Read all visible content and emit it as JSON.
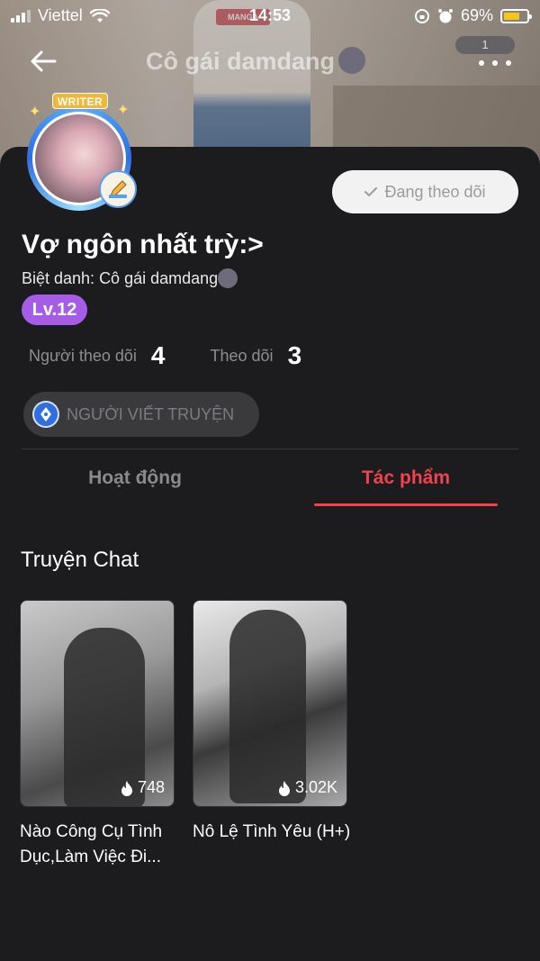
{
  "status_bar": {
    "carrier": "Viettel",
    "time": "14:53",
    "battery_percent": "69%",
    "battery_level": 0.69
  },
  "header": {
    "title": "Cô gái damdang",
    "notification_count": "1"
  },
  "profile": {
    "writer_tag": "WRITER",
    "follow_button": "Đang theo dõi",
    "name": "Vợ ngôn nhất trỳ:>",
    "nickname": "Biệt danh: Cô gái damdang",
    "level": "Lv.12",
    "followers_label": "Người theo dõi",
    "followers_count": "4",
    "following_label": "Theo dõi",
    "following_count": "3",
    "role": "NGƯỜI VIẾT TRUYỆN"
  },
  "tabs": [
    {
      "label": "Hoạt động",
      "active": false
    },
    {
      "label": "Tác phẩm",
      "active": true
    }
  ],
  "section": {
    "title": "Truyện Chat"
  },
  "stories": [
    {
      "views": "748",
      "title": "Nào Công Cụ Tình Dục,Làm Việc Đi..."
    },
    {
      "views": "3.02K",
      "title": "Nô Lệ Tình Yêu (H+)"
    }
  ],
  "colors": {
    "accent": "#f0424f",
    "level_badge": "#a55de8",
    "background": "#1c1c1e"
  }
}
